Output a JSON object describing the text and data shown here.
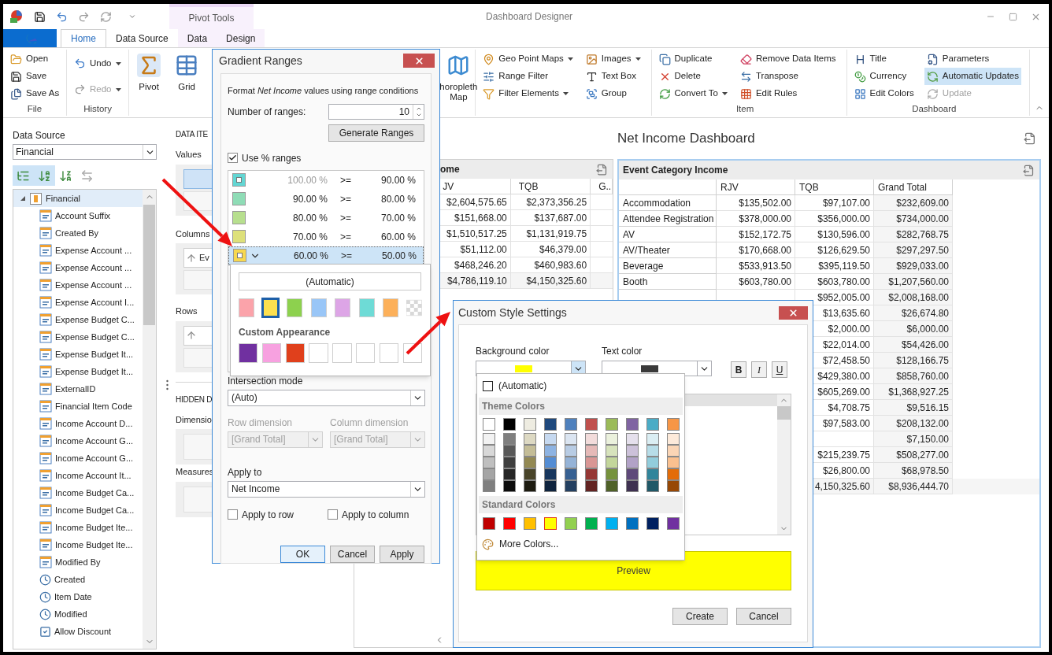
{
  "title_bar": {
    "title": "Dashboard Designer",
    "context_group": "Pivot Tools"
  },
  "tabs": [
    {
      "label": "Home",
      "selected": true,
      "context": false
    },
    {
      "label": "Data Source",
      "selected": false,
      "context": false
    },
    {
      "label": "Data",
      "selected": false,
      "context": true
    },
    {
      "label": "Design",
      "selected": false,
      "context": true
    }
  ],
  "ribbon": {
    "groups": [
      {
        "label": "File",
        "columns": [
          [
            {
              "label": "Open",
              "kind": "small",
              "dropdown": false,
              "disabled": false,
              "on": false
            },
            {
              "label": "Save",
              "kind": "small",
              "dropdown": false,
              "disabled": false,
              "on": false
            },
            {
              "label": "Save As",
              "kind": "small",
              "dropdown": false,
              "disabled": false,
              "on": false
            }
          ]
        ]
      },
      {
        "label": "History",
        "columns": [
          [
            {
              "label": "Undo",
              "kind": "small",
              "dropdown": true,
              "disabled": false,
              "on": false
            },
            {
              "label": "Redo",
              "kind": "small",
              "dropdown": true,
              "disabled": true,
              "on": false
            }
          ]
        ]
      },
      {
        "columns": [
          [
            {
              "label": "Pivot",
              "kind": "large",
              "disabled": false,
              "on": false
            }
          ],
          [
            {
              "label": "Grid",
              "kind": "large",
              "disabled": false,
              "on": false
            }
          ]
        ]
      },
      {
        "columns": [
          [
            {
              "label": "horopleth Map",
              "kind": "large",
              "disabled": false,
              "on": false
            }
          ]
        ]
      },
      {
        "columns": [
          [
            {
              "label": "Geo Point Maps",
              "kind": "small",
              "dropdown": true,
              "disabled": false,
              "on": false
            },
            {
              "label": "Range Filter",
              "kind": "small",
              "dropdown": false,
              "disabled": false,
              "on": false
            },
            {
              "label": "Filter Elements",
              "kind": "small",
              "dropdown": true,
              "disabled": false,
              "on": false
            }
          ],
          [
            {
              "label": "Images",
              "kind": "small",
              "dropdown": true,
              "disabled": false,
              "on": false
            },
            {
              "label": "Text Box",
              "kind": "small",
              "dropdown": false,
              "disabled": false,
              "on": false
            },
            {
              "label": "Group",
              "kind": "small",
              "dropdown": false,
              "disabled": false,
              "on": false
            }
          ]
        ]
      },
      {
        "label": "Item",
        "columns": [
          [
            {
              "label": "Duplicate",
              "kind": "small",
              "dropdown": false,
              "disabled": false,
              "on": false
            },
            {
              "label": "Delete",
              "kind": "small",
              "dropdown": false,
              "disabled": false,
              "on": false
            },
            {
              "label": "Convert To",
              "kind": "small",
              "dropdown": true,
              "disabled": false,
              "on": false
            }
          ],
          [
            {
              "label": "Remove Data Items",
              "kind": "small",
              "dropdown": false,
              "disabled": false,
              "on": false
            },
            {
              "label": "Transpose",
              "kind": "small",
              "dropdown": false,
              "disabled": false,
              "on": false
            },
            {
              "label": "Edit Rules",
              "kind": "small",
              "dropdown": false,
              "disabled": false,
              "on": false
            }
          ]
        ]
      },
      {
        "label": "Dashboard",
        "columns": [
          [
            {
              "label": "Title",
              "kind": "small",
              "dropdown": false,
              "disabled": false,
              "on": false
            },
            {
              "label": "Currency",
              "kind": "small",
              "dropdown": false,
              "disabled": false,
              "on": false
            },
            {
              "label": "Edit Colors",
              "kind": "small",
              "dropdown": false,
              "disabled": false,
              "on": false
            }
          ],
          [
            {
              "label": "Parameters",
              "kind": "small",
              "dropdown": false,
              "disabled": false,
              "on": false
            },
            {
              "label": "Automatic Updates",
              "kind": "small",
              "dropdown": false,
              "disabled": false,
              "on": true
            },
            {
              "label": "Update",
              "kind": "small",
              "dropdown": false,
              "disabled": true,
              "on": false
            }
          ]
        ]
      }
    ]
  },
  "data_source": {
    "label": "Data Source",
    "value": "Financial",
    "toolbar": [
      {
        "selected": true
      },
      {
        "selected": true
      },
      {
        "selected": false
      },
      {
        "selected": false
      }
    ],
    "tree": [
      {
        "label": "Financial",
        "expanded": true,
        "selected": true,
        "children": [
          {
            "label": "Account Suffix",
            "kind": "text"
          },
          {
            "label": "Created By",
            "kind": "text"
          },
          {
            "label": "Expense Account ...",
            "kind": "text"
          },
          {
            "label": "Expense Account ...",
            "kind": "text"
          },
          {
            "label": "Expense Account ...",
            "kind": "text"
          },
          {
            "label": "Expense Account I...",
            "kind": "text"
          },
          {
            "label": "Expense Budget C...",
            "kind": "text"
          },
          {
            "label": "Expense Budget C...",
            "kind": "text"
          },
          {
            "label": "Expense Budget It...",
            "kind": "text"
          },
          {
            "label": "Expense Budget It...",
            "kind": "text"
          },
          {
            "label": "ExternalID",
            "kind": "text"
          },
          {
            "label": "Financial Item Code",
            "kind": "text"
          },
          {
            "label": "Income Account D...",
            "kind": "text"
          },
          {
            "label": "Income Account G...",
            "kind": "text"
          },
          {
            "label": "Income Account G...",
            "kind": "text"
          },
          {
            "label": "Income Account It...",
            "kind": "text"
          },
          {
            "label": "Income Budget Ca...",
            "kind": "text"
          },
          {
            "label": "Income Budget Ca...",
            "kind": "text"
          },
          {
            "label": "Income Budget Ite...",
            "kind": "text"
          },
          {
            "label": "Income Budget Ite...",
            "kind": "text"
          },
          {
            "label": "Modified By",
            "kind": "text"
          },
          {
            "label": "Created",
            "kind": "date"
          },
          {
            "label": "Item Date",
            "kind": "date"
          },
          {
            "label": "Modified",
            "kind": "date"
          },
          {
            "label": "Allow Discount",
            "kind": "bool"
          }
        ]
      }
    ]
  },
  "data_items": {
    "title": "DATA ITE",
    "sections": [
      {
        "label": "Values",
        "slots": [
          {
            "kind": "measure"
          },
          {
            "kind": "empty"
          }
        ]
      },
      {
        "label": "Columns",
        "slots": [
          {
            "kind": "dimension",
            "text": "Ev"
          },
          {
            "kind": "empty"
          }
        ]
      },
      {
        "label": "Rows",
        "slots": [
          {
            "kind": "dimension"
          },
          {
            "kind": "empty"
          }
        ]
      }
    ],
    "hidden_title": "HIDDEN D",
    "hidden_sections": [
      {
        "label": "Dimensio",
        "slots": [
          {
            "kind": "empty"
          }
        ]
      },
      {
        "label": "Measures",
        "slots": [
          {
            "kind": "empty"
          }
        ]
      }
    ]
  },
  "dashboard": {
    "title": "Net Income Dashboard"
  },
  "pivot_left": {
    "title": "ome",
    "columns": [
      "JV",
      "TQB",
      "G..."
    ],
    "rows": [
      [
        "$2,604,575.65",
        "$2,373,356.25"
      ],
      [
        "$151,668.00",
        "$137,687.00"
      ],
      [
        "$1,510,517.25",
        "$1,131,919.75"
      ],
      [
        "$51,112.00",
        "$46,379.00"
      ],
      [
        "$468,246.20",
        "$460,983.60"
      ],
      [
        "$4,786,119.10",
        "$4,150,325.60"
      ]
    ]
  },
  "pivot_right": {
    "title": "Event Category Income",
    "columns": [
      "RJV",
      "TQB",
      "Grand Total"
    ],
    "rows": [
      {
        "label": "Accommodation",
        "rjv": "$135,502.00",
        "tqb": "$97,107.00",
        "total": "$232,609.00"
      },
      {
        "label": "Attendee Registration",
        "rjv": "$378,000.00",
        "tqb": "$356,000.00",
        "total": "$734,000.00"
      },
      {
        "label": "AV",
        "rjv": "$152,172.75",
        "tqb": "$130,596.00",
        "total": "$282,768.75"
      },
      {
        "label": "AV/Theater",
        "rjv": "$170,668.00",
        "tqb": "$126,629.50",
        "total": "$297,297.50"
      },
      {
        "label": "Beverage",
        "rjv": "$533,913.50",
        "tqb": "$395,119.50",
        "total": "$929,033.00"
      },
      {
        "label": "Booth",
        "rjv": "$603,780.00",
        "tqb": "$603,780.00",
        "total": "$1,207,560.00"
      },
      {
        "tqb": "$952,005.00",
        "total": "$2,008,168.00"
      },
      {
        "tqb": "$13,635.60",
        "total": "$26,674.80"
      },
      {
        "tqb": "$2,000.00",
        "total": "$6,000.00"
      },
      {
        "tqb": "$22,014.00",
        "total": "$54,426.00"
      },
      {
        "tqb": "$72,458.50",
        "total": "$128,166.75"
      },
      {
        "tqb": "$429,380.00",
        "total": "$858,760.00"
      },
      {
        "tqb": "$605,269.00",
        "total": "$1,368,927.25"
      },
      {
        "tqb": "$4,708.75",
        "total": "$9,516.15"
      },
      {
        "tqb": "$97,583.00",
        "total": "$208,132.00"
      },
      {
        "total": "$7,150.00"
      },
      {
        "tqb": "$215,239.75",
        "total": "$508,277.00"
      },
      {
        "tqb": "$26,800.00",
        "total": "$68,978.50"
      },
      {
        "tqb": "4,150,325.60",
        "total": "$8,936,444.70"
      }
    ]
  },
  "gradient_dialog": {
    "title": "Gradient Ranges",
    "intro": "Format *Net Income* values using range conditions",
    "count_label": "Number of ranges:",
    "count_value": "10",
    "generate_button": "Generate Ranges",
    "use_percent": {
      "label": "Use % ranges",
      "checked": true
    },
    "ranges": [
      {
        "color": "#63d6d3",
        "marker": true,
        "from": "100.00 %",
        "from_disabled": true,
        "op": ">=",
        "to": "90.00 %",
        "selected": false
      },
      {
        "color": "#8fdcb6",
        "marker": false,
        "from": "90.00 %",
        "from_disabled": false,
        "op": ">=",
        "to": "80.00 %",
        "selected": false
      },
      {
        "color": "#b7df8e",
        "marker": false,
        "from": "80.00 %",
        "from_disabled": false,
        "op": ">=",
        "to": "70.00 %",
        "selected": false
      },
      {
        "color": "#dde07a",
        "marker": false,
        "from": "70.00 %",
        "from_disabled": false,
        "op": ">=",
        "to": "60.00 %",
        "selected": false
      },
      {
        "color": "#f7d84e",
        "marker": true,
        "from": "60.00 %",
        "from_disabled": false,
        "op": ">=",
        "to": "50.00 %",
        "selected": true
      }
    ],
    "palette": {
      "automatic": "(Automatic)",
      "colors": [
        {
          "kind": "color",
          "color": "#fba3aa",
          "selected": false
        },
        {
          "kind": "color",
          "color": "#fde04f",
          "selected": true
        },
        {
          "kind": "color",
          "color": "#8dd14e",
          "selected": false
        },
        {
          "kind": "color",
          "color": "#99c6f7",
          "selected": false
        },
        {
          "kind": "color",
          "color": "#dda5e6",
          "selected": false
        },
        {
          "kind": "color",
          "color": "#6edbd6",
          "selected": false
        },
        {
          "kind": "color",
          "color": "#fcb05a",
          "selected": false
        },
        {
          "kind": "none",
          "selected": false
        }
      ],
      "custom_title": "Custom Appearance",
      "custom": [
        {
          "kind": "color",
          "color": "#7030a0"
        },
        {
          "kind": "color",
          "color": "#f7a1e0"
        },
        {
          "kind": "color",
          "color": "#e0401c"
        },
        {
          "kind": "empty"
        },
        {
          "kind": "empty"
        },
        {
          "kind": "empty"
        },
        {
          "kind": "empty"
        },
        {
          "kind": "empty"
        }
      ]
    },
    "intersection": {
      "label": "Intersection mode",
      "value": "(Auto)",
      "disabled": false
    },
    "row_dimension": {
      "label": "Row dimension",
      "value": "[Grand Total]",
      "disabled": true
    },
    "column_dimension": {
      "label": "Column dimension",
      "value": "[Grand Total]",
      "disabled": true
    },
    "apply_to": {
      "label": "Apply to",
      "value": "Net Income",
      "disabled": false
    },
    "apply_row": {
      "label": "Apply to row",
      "checked": false
    },
    "apply_column": {
      "label": "Apply to column",
      "checked": false
    },
    "buttons": [
      {
        "label": "OK",
        "default": true
      },
      {
        "label": "Cancel",
        "default": false
      },
      {
        "label": "Apply",
        "default": false
      }
    ]
  },
  "style_dialog": {
    "title": "Custom Style Settings",
    "background": {
      "label": "Background color",
      "color": "#ffff00",
      "open": true
    },
    "text_color": {
      "label": "Text color",
      "color": "#3a3a3a",
      "open": false
    },
    "format_buttons": [
      {
        "label": "B",
        "kind": "bold",
        "on": false
      },
      {
        "label": "I",
        "kind": "italic",
        "on": false
      },
      {
        "label": "U",
        "kind": "underline",
        "on": false
      }
    ],
    "preview": "Preview",
    "buttons": [
      "Create",
      "Cancel"
    ],
    "color_picker": {
      "automatic": "(Automatic)",
      "theme_title": "Theme Colors",
      "theme": [
        {
          "color": "#ffffff",
          "shades": [
            {
              "color": "#f2f2f2"
            },
            {
              "color": "#d8d8d8"
            },
            {
              "color": "#bfbfbf"
            },
            {
              "color": "#a5a5a5"
            },
            {
              "color": "#7f7f7f"
            }
          ]
        },
        {
          "color": "#000000",
          "shades": [
            {
              "color": "#7f7f7f"
            },
            {
              "color": "#595959"
            },
            {
              "color": "#3f3f3f"
            },
            {
              "color": "#262626"
            },
            {
              "color": "#0c0c0c"
            }
          ]
        },
        {
          "color": "#eeece1",
          "shades": [
            {
              "color": "#ddd9c3"
            },
            {
              "color": "#c4bd97"
            },
            {
              "color": "#938953"
            },
            {
              "color": "#494429"
            },
            {
              "color": "#1d1b10"
            }
          ]
        },
        {
          "color": "#1f497d",
          "shades": [
            {
              "color": "#c6d9f0"
            },
            {
              "color": "#8db3e2"
            },
            {
              "color": "#548dd4"
            },
            {
              "color": "#17365d"
            },
            {
              "color": "#0f243e"
            }
          ]
        },
        {
          "color": "#4f81bd",
          "shades": [
            {
              "color": "#dbe5f1"
            },
            {
              "color": "#b8cce4"
            },
            {
              "color": "#95b3d7"
            },
            {
              "color": "#366092"
            },
            {
              "color": "#244061"
            }
          ]
        },
        {
          "color": "#c0504d",
          "shades": [
            {
              "color": "#f2dcdb"
            },
            {
              "color": "#e5b9b7"
            },
            {
              "color": "#d99694"
            },
            {
              "color": "#953734"
            },
            {
              "color": "#632423"
            }
          ]
        },
        {
          "color": "#9bbb59",
          "shades": [
            {
              "color": "#ebf1dd"
            },
            {
              "color": "#d7e3bc"
            },
            {
              "color": "#c3d69b"
            },
            {
              "color": "#76923c"
            },
            {
              "color": "#4f6128"
            }
          ]
        },
        {
          "color": "#8064a2",
          "shades": [
            {
              "color": "#e5e0ec"
            },
            {
              "color": "#ccc1d9"
            },
            {
              "color": "#b2a2c7"
            },
            {
              "color": "#5f497a"
            },
            {
              "color": "#3f3151"
            }
          ]
        },
        {
          "color": "#4bacc6",
          "shades": [
            {
              "color": "#dbeef3"
            },
            {
              "color": "#b7dde8"
            },
            {
              "color": "#92cddc"
            },
            {
              "color": "#31859b"
            },
            {
              "color": "#205867"
            }
          ]
        },
        {
          "color": "#f79646",
          "shades": [
            {
              "color": "#fdeada"
            },
            {
              "color": "#fbd5b5"
            },
            {
              "color": "#fac08f"
            },
            {
              "color": "#e36c09"
            },
            {
              "color": "#974806"
            }
          ]
        }
      ],
      "standard_title": "Standard Colors",
      "standard": [
        {
          "color": "#c00000",
          "selected": false
        },
        {
          "color": "#ff0000",
          "selected": false
        },
        {
          "color": "#ffc000",
          "selected": false
        },
        {
          "color": "#ffff00",
          "selected": true
        },
        {
          "color": "#92d050",
          "selected": false
        },
        {
          "color": "#00b050",
          "selected": false
        },
        {
          "color": "#00b0f0",
          "selected": false
        },
        {
          "color": "#0070c0",
          "selected": false
        },
        {
          "color": "#002060",
          "selected": false
        },
        {
          "color": "#7030a0",
          "selected": false
        }
      ],
      "more": "More Colors..."
    }
  }
}
